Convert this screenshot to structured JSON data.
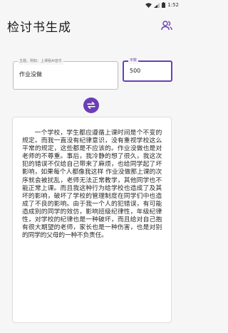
{
  "status_bar": {
    "time": "1:52"
  },
  "app_bar": {
    "title": "检讨书生成"
  },
  "topic_field": {
    "label": "主题，例如：上课看AI音乐",
    "value": "作业没做"
  },
  "count_field": {
    "label": "字数",
    "value": "500"
  },
  "result": {
    "text": "一个学校，学生都应遵循上课时间是个不变的规定。而我一直没有纪律意识，没有重视学校这么平常的规定，这些都是不应该的。作业没做也是对老师的不尊重。事后，我冷静的想了很久，我这次犯的错误不仅给自己带来了麻烦，也给同学起了坏影响，如果每个人都像我这样 作业没做那上课的次序就会被扰乱，老师无法正常教学，其他同学也不能正常上课。而且我这种行为给学校也造成了及其坏的影响，破坏了学校的管理制度在同学们中也造成了不良的影响。由于我一个人的犯错误，有可能造成别的同学的效仿，影响班级纪律性，年级纪律性，对学校的纪律也是一种破坏，而且给对自己抱有很大期望的老师，家长也是一种伤害，也是对别的同学的父母的一种不负责任。"
  },
  "colors": {
    "accent": "#6a3fb5",
    "background": "#f6f6f7"
  }
}
